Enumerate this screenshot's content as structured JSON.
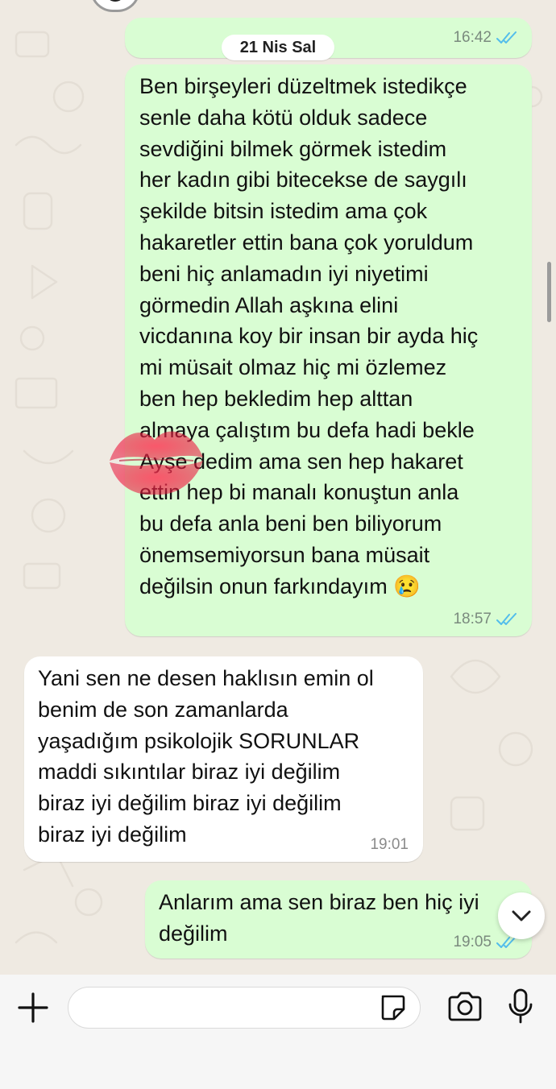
{
  "chat": {
    "date_label": "21 Nis Sal",
    "messages": [
      {
        "direction": "outgoing",
        "text": "Ben birşeyleri düzeltmek istedikçe\nsenle daha kötü olduk sadece\nsevdiğini bilmek görmek istedim\nher kadın gibi bitecekse de saygılı\nşekilde bitsin istedim ama çok\nhakaretler ettin bana çok yoruldum\nbeni hiç anlamadın iyi niyetimi\ngörmedin Allah aşkına elini\nvicdanına koy bir insan bir ayda hiç\nmi müsait olmaz hiç mi özlemez\nben hep bekledim hep alttan\nalmaya çalıştım bu defa hadi bekle\nAyşe dedim ama sen hep hakaret\nettin hep bi manalı konuştun anla\nbu defa anla beni ben biliyorum\nönemsemiyorsun bana müsait\ndeğilsin onun farkındayım 😢",
        "time": "18:57",
        "status": "read"
      },
      {
        "direction": "incoming",
        "text": "Yani sen ne desen haklısın emin ol\nbenim de son zamanlarda\nyaşadığım psikolojik SORUNLAR\nmaddi sıkıntılar biraz iyi değilim\nbiraz iyi değilim biraz iyi değilim\nbiraz iyi değilim",
        "time": "19:01"
      },
      {
        "direction": "outgoing",
        "text": "Anlarım ama sen biraz ben hiç iyi\ndeğilim",
        "time": "19:05",
        "status": "read"
      }
    ],
    "previous_message_time": "16:42"
  },
  "composer": {
    "input_value": "",
    "icons": {
      "attach": "plus-icon",
      "sticker": "sticker-icon",
      "camera": "camera-icon",
      "mic": "microphone-icon",
      "scroll": "chevron-down-icon"
    }
  },
  "colors": {
    "outgoing_bubble": "#d9fdd3",
    "incoming_bubble": "#ffffff",
    "read_ticks": "#53bdeb",
    "background": "#efeae2"
  }
}
